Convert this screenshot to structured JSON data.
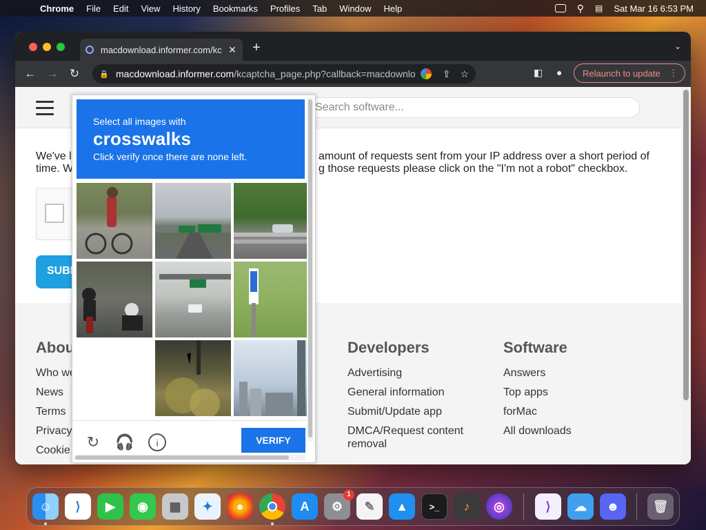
{
  "menubar": {
    "apple": "",
    "app": "Chrome",
    "items": [
      "File",
      "Edit",
      "View",
      "History",
      "Bookmarks",
      "Profiles",
      "Tab",
      "Window",
      "Help"
    ],
    "datetime": "Sat Mar 16  6:53 PM"
  },
  "browser": {
    "tab_title": "macdownload.informer.com/kc",
    "url_domain": "macdownload.informer.com",
    "url_path": "/kcaptcha_page.php?callback=macdownload...",
    "relaunch_label": "Relaunch to update"
  },
  "page": {
    "search_placeholder": "Search software...",
    "message": "We've limited the amount of requests sent from your IP address over a short period of time. W… those requests please click on the \"I'm not a robot\" checkbox.",
    "message_left": "We've l",
    "message_left2": "time. W",
    "message_right1": "amount of requests sent from your IP address over a short period of",
    "message_right2": "g those requests please click on the \"I'm not a robot\" checkbox.",
    "submit_label": "SUBMIT",
    "footer": {
      "about_title": "About",
      "about_links": [
        "Who we are",
        "News",
        "Terms",
        "Privacy",
        "Cookie"
      ],
      "dev_title": "Developers",
      "dev_links": [
        "Advertising",
        "General information",
        "Submit/Update app",
        "DMCA/Request content removal"
      ],
      "soft_title": "Software",
      "soft_links": [
        "Answers",
        "Top apps",
        "forMac",
        "All downloads"
      ]
    }
  },
  "captcha": {
    "line1": "Select all images with",
    "target": "crosswalks",
    "line3": "Click verify once there are none left.",
    "verify_label": "VERIFY",
    "tiles": [
      "bicycle-on-road",
      "highway-overpass-sign",
      "guardrail-trees",
      "motorcycles-riders",
      "highway-gantry",
      "bike-sign-grass",
      "empty",
      "tree-foliage",
      "city-skyline"
    ]
  },
  "dock": {
    "apps": [
      "Finder",
      "Visual Studio Code",
      "FaceTime",
      "Messages",
      "Launchpad",
      "Safari",
      "Firefox",
      "Chrome",
      "App Store",
      "System Settings",
      "TextEdit",
      "Keynote",
      "Terminal",
      "GarageBand",
      "Siri",
      "Visual Studio",
      "Weather",
      "Discord",
      "Trash"
    ],
    "settings_badge": "1"
  }
}
